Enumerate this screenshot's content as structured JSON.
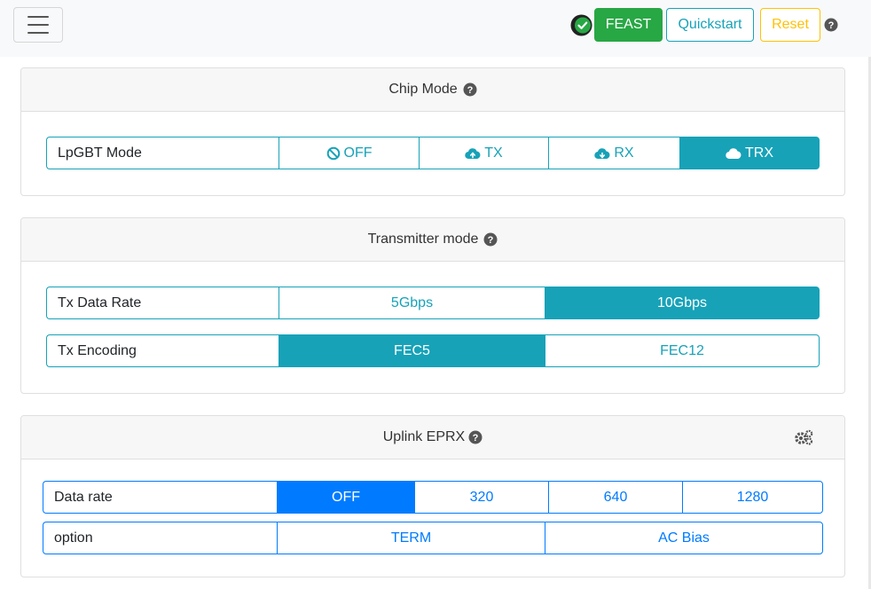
{
  "topbar": {
    "feast_label": "FEAST",
    "quickstart_label": "Quickstart",
    "reset_label": "Reset"
  },
  "colors": {
    "teal": "#17a2b8",
    "blue": "#007bff",
    "green": "#28a745",
    "yellow": "#ffc107"
  },
  "chip_mode": {
    "title": "Chip Mode",
    "row_label": "LpGBT Mode",
    "options": [
      {
        "label": "OFF",
        "icon": "ban-icon",
        "active": false
      },
      {
        "label": "TX",
        "icon": "cloud-upload-icon",
        "active": false
      },
      {
        "label": "RX",
        "icon": "cloud-download-icon",
        "active": false
      },
      {
        "label": "TRX",
        "icon": "cloud-icon",
        "active": true
      }
    ]
  },
  "transmitter_mode": {
    "title": "Transmitter mode",
    "data_rate": {
      "label": "Tx Data Rate",
      "options": [
        {
          "label": "5Gbps",
          "active": false
        },
        {
          "label": "10Gbps",
          "active": true
        }
      ]
    },
    "encoding": {
      "label": "Tx Encoding",
      "options": [
        {
          "label": "FEC5",
          "active": true
        },
        {
          "label": "FEC12",
          "active": false
        }
      ]
    }
  },
  "uplink_eprx": {
    "title": "Uplink EPRX",
    "data_rate": {
      "label": "Data rate",
      "options": [
        {
          "label": "OFF",
          "active": true
        },
        {
          "label": "320",
          "active": false
        },
        {
          "label": "640",
          "active": false
        },
        {
          "label": "1280",
          "active": false
        }
      ]
    },
    "option": {
      "label": "option",
      "options": [
        {
          "label": "TERM",
          "active": false
        },
        {
          "label": "AC Bias",
          "active": false
        }
      ]
    }
  }
}
